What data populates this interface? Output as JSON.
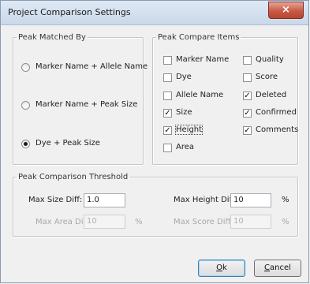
{
  "window": {
    "title": "Project Comparison Settings",
    "close_glyph": "×"
  },
  "peak_matched_by": {
    "legend": "Peak Matched By",
    "options": [
      {
        "label": "Marker Name + Allele Name",
        "selected": false
      },
      {
        "label": "Marker Name + Peak Size",
        "selected": false
      },
      {
        "label": "Dye + Peak Size",
        "selected": true
      }
    ]
  },
  "peak_compare_items": {
    "legend": "Peak Compare Items",
    "items": [
      {
        "label": "Marker Name",
        "checked": false
      },
      {
        "label": "Dye",
        "checked": false
      },
      {
        "label": "Allele Name",
        "checked": false
      },
      {
        "label": "Size",
        "checked": true
      },
      {
        "label": "Height",
        "checked": true
      },
      {
        "label": "Area",
        "checked": false
      },
      {
        "label": "Quality",
        "checked": false
      },
      {
        "label": "Score",
        "checked": false
      },
      {
        "label": "Deleted",
        "checked": true
      },
      {
        "label": "Confirmed",
        "checked": true
      },
      {
        "label": "Comments",
        "checked": true
      }
    ]
  },
  "threshold": {
    "legend": "Peak Comparison Threshold",
    "max_size_label": "Max Size Diff:",
    "max_size_value": "1.0",
    "max_height_label": "Max Height Diff:",
    "max_height_value": "10",
    "max_height_unit": "%",
    "max_area_label": "Max Area Diff:",
    "max_area_value": "10",
    "max_area_unit": "%",
    "max_score_label": "Max Score Diff:",
    "max_score_value": "10",
    "max_score_unit": "%"
  },
  "buttons": {
    "ok_first": "O",
    "ok_rest": "k",
    "cancel_first": "C",
    "cancel_rest": "ancel"
  }
}
